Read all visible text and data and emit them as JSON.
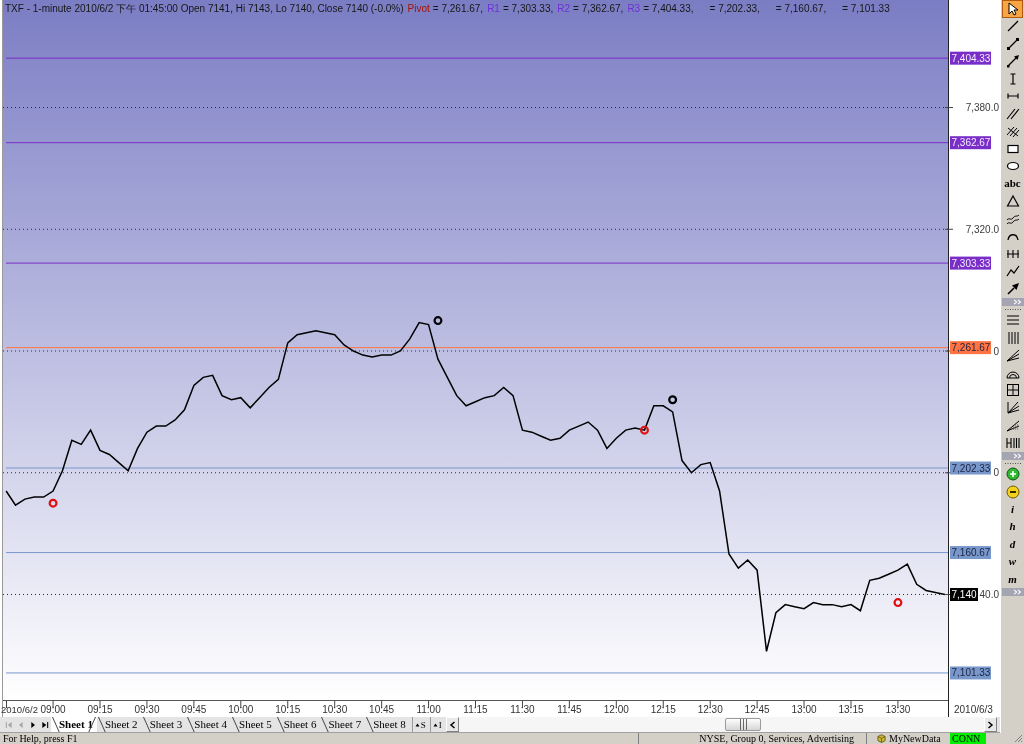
{
  "chart": {
    "info": "TXF - 1-minute 2010/6/2 下午 01:45:00 Open 7141, Hi 7143, Lo 7140, Close 7140 (-0.0%)",
    "legend": [
      {
        "name": "Pivot",
        "value": "= 7,261.67,",
        "color": "#a81000"
      },
      {
        "name": "R1",
        "value": "= 7,303.33,",
        "color": "#7030d8"
      },
      {
        "name": "R2",
        "value": "= 7,362.67,",
        "color": "#7030d8"
      },
      {
        "name": "R3",
        "value": "= 7,404.33,",
        "color": "#7030d8"
      },
      {
        "value": "= 7,202.33,"
      },
      {
        "value": "= 7,160.67,"
      },
      {
        "value": "= 7,101.33"
      }
    ],
    "chart_data": {
      "type": "line",
      "categories": [
        null,
        null,
        null,
        null,
        null,
        "09:00",
        null,
        null,
        null,
        null,
        "09:15",
        null,
        null,
        null,
        null,
        "09:30",
        null,
        null,
        null,
        null,
        "09:45",
        null,
        null,
        null,
        null,
        "10:00",
        null,
        null,
        null,
        null,
        "10:15",
        null,
        null,
        null,
        null,
        "10:30",
        null,
        null,
        null,
        null,
        "10:45",
        null,
        null,
        null,
        null,
        "11:00",
        null,
        null,
        null,
        null,
        "11:15",
        null,
        null,
        null,
        null,
        "11:30",
        null,
        null,
        null,
        null,
        "11:45",
        null,
        null,
        null,
        null,
        "12:00",
        null,
        null,
        null,
        null,
        "12:15",
        null,
        null,
        null,
        null,
        "12:30",
        null,
        null,
        null,
        null,
        "12:45",
        null,
        null,
        null,
        null,
        "13:00",
        null,
        null,
        null,
        null,
        "13:15",
        null,
        null,
        null,
        null,
        "13:30",
        null,
        null,
        null,
        null,
        null
      ],
      "ylim": [
        7088,
        7433
      ],
      "yticks": [
        {
          "value": 7380,
          "label": "7,380.0"
        },
        {
          "value": 7320,
          "label": "7,320.0"
        }
      ],
      "series": [
        {
          "color": "#000000",
          "values": [
            7191,
            7184,
            7187,
            7188,
            7188,
            7191,
            7201,
            7216,
            7214,
            7221,
            7211,
            7209,
            7205,
            7201,
            7212,
            7220,
            7223,
            7223,
            7226,
            7231,
            7243,
            7247,
            7248,
            7238,
            7236,
            7237,
            7232,
            7237,
            7242,
            7246,
            7264,
            7268,
            7269,
            7270,
            7269,
            7268,
            7263,
            7260,
            7258,
            7257,
            7258,
            7258,
            7260,
            7266,
            7274,
            7273,
            7256,
            7247,
            7238,
            7233,
            7235,
            7237,
            7238,
            7242,
            7238,
            7221,
            7220,
            7218,
            7216,
            7217,
            7221,
            7223,
            7225,
            7221,
            7212,
            7217,
            7221,
            7222,
            7221,
            7233,
            7233,
            7230,
            7206,
            7200,
            7204,
            7205,
            7191,
            7160,
            7153,
            7157,
            7152,
            7112,
            7131,
            7135,
            7134,
            7133,
            7136,
            7135,
            7135,
            7134,
            7135,
            7132,
            7147,
            7148,
            7150,
            7152,
            7155,
            7145,
            7142,
            7141,
            7140
          ]
        },
        {
          "type": "scatter",
          "color": "#e01010",
          "values": [
            null,
            null,
            null,
            null,
            null,
            7185,
            null,
            null,
            null,
            null,
            null,
            null,
            null,
            null,
            null,
            null,
            null,
            null,
            null,
            null,
            null,
            null,
            null,
            null,
            null,
            null,
            null,
            null,
            null,
            null,
            null,
            null,
            null,
            null,
            null,
            null,
            null,
            null,
            null,
            null,
            null,
            null,
            null,
            null,
            null,
            null,
            null,
            null,
            null,
            null,
            null,
            null,
            null,
            null,
            null,
            null,
            null,
            null,
            null,
            null,
            null,
            null,
            null,
            null,
            null,
            null,
            null,
            null,
            7221,
            null,
            null,
            null,
            null,
            null,
            null,
            null,
            null,
            null,
            null,
            null,
            null,
            null,
            null,
            null,
            null,
            null,
            null,
            null,
            null,
            null,
            null,
            null,
            null,
            null,
            null,
            7136,
            null,
            null,
            null,
            null,
            null
          ]
        },
        {
          "type": "scatter",
          "color": "#000000",
          "values": [
            null,
            null,
            null,
            null,
            null,
            null,
            null,
            null,
            null,
            null,
            null,
            null,
            null,
            null,
            null,
            null,
            null,
            null,
            null,
            null,
            null,
            null,
            null,
            null,
            null,
            null,
            null,
            null,
            null,
            null,
            null,
            null,
            null,
            null,
            null,
            null,
            null,
            null,
            null,
            null,
            null,
            null,
            null,
            null,
            null,
            null,
            7275,
            null,
            null,
            null,
            null,
            null,
            null,
            null,
            null,
            null,
            null,
            null,
            null,
            null,
            null,
            null,
            null,
            null,
            null,
            null,
            null,
            null,
            null,
            null,
            null,
            7236,
            null,
            null,
            null,
            null,
            null,
            null,
            null,
            null,
            null,
            null,
            null,
            null,
            null,
            null,
            null,
            null,
            null,
            null,
            null,
            null,
            null,
            null,
            null,
            null,
            null,
            null,
            null,
            null,
            null
          ]
        }
      ],
      "ref_lines": [
        {
          "axis": "y",
          "value": 7404.33,
          "label": "7,404.33",
          "color": "#7a2ec8"
        },
        {
          "axis": "y",
          "value": 7362.67,
          "label": "7,362.67",
          "color": "#7a2ec8"
        },
        {
          "axis": "y",
          "value": 7303.33,
          "label": "7,303.33",
          "color": "#7a2ec8"
        },
        {
          "axis": "y",
          "value": 7261.67,
          "label": "7,261.67",
          "color": "#ff7442"
        },
        {
          "axis": "y",
          "value": 7202.33,
          "label": "7,202.33",
          "color": "#7898cc"
        },
        {
          "axis": "y",
          "value": 7160.67,
          "label": "7,160.67",
          "color": "#7898cc"
        },
        {
          "axis": "y",
          "value": 7101.33,
          "label": "7,101.33",
          "color": "#7898cc"
        }
      ]
    },
    "covered_tick_labels": [
      "0",
      "0",
      "40.0"
    ],
    "last_price": {
      "label": "7,140"
    },
    "x_start_label": "2010/6/2",
    "x_end_label": "2010/6/3"
  },
  "toolbar": {
    "groups": [
      {
        "tools": [
          {
            "selected": true
          },
          {
            "selected": false
          },
          {
            "selected": false
          },
          {
            "selected": false
          },
          {
            "selected": false
          },
          {
            "selected": false
          },
          {
            "selected": false
          },
          {
            "selected": false
          },
          {
            "selected": false
          },
          {
            "selected": false
          },
          {
            "label": "abc",
            "selected": false
          },
          {
            "selected": false
          },
          {
            "selected": false
          },
          {
            "selected": false
          },
          {
            "selected": false
          },
          {
            "selected": false
          },
          {
            "selected": false
          }
        ]
      },
      {
        "tools": [
          {
            "selected": false
          },
          {
            "selected": false
          },
          {
            "selected": false
          },
          {
            "selected": false
          },
          {
            "selected": false
          },
          {
            "selected": false
          },
          {
            "selected": false
          },
          {
            "selected": false
          }
        ]
      },
      {
        "tools": [
          {
            "selected": false
          },
          {
            "selected": false
          },
          {
            "label": "i",
            "selected": false
          },
          {
            "label": "h",
            "selected": false
          },
          {
            "label": "d",
            "selected": false
          },
          {
            "label": "w",
            "selected": false
          },
          {
            "label": "m",
            "selected": false
          }
        ]
      }
    ]
  },
  "sheets": {
    "nav": [
      {
        "kind": "first",
        "disabled": true
      },
      {
        "kind": "previous",
        "disabled": true
      },
      {
        "kind": "next",
        "disabled": false
      },
      {
        "kind": "last",
        "disabled": false
      }
    ],
    "tabs": [
      {
        "label": "Sheet 1",
        "selected": true
      },
      {
        "label": "Sheet 2",
        "selected": false
      },
      {
        "label": "Sheet 3",
        "selected": false
      },
      {
        "label": "Sheet 4",
        "selected": false
      },
      {
        "label": "Sheet 5",
        "selected": false
      },
      {
        "label": "Sheet 6",
        "selected": false
      },
      {
        "label": "Sheet 7",
        "selected": false
      },
      {
        "label": "Sheet 8",
        "selected": false
      }
    ],
    "buttons": [
      {
        "label": "S"
      },
      {
        "label": "I"
      }
    ]
  },
  "status_bar": {
    "help": "For Help, press F1",
    "panels": [
      {
        "kind": "text",
        "text": "NYSE, Group 0, Services, Advertising"
      },
      {
        "kind": "source",
        "text": "MyNewData"
      }
    ],
    "connection": {
      "text": "CONN",
      "on": true
    }
  }
}
